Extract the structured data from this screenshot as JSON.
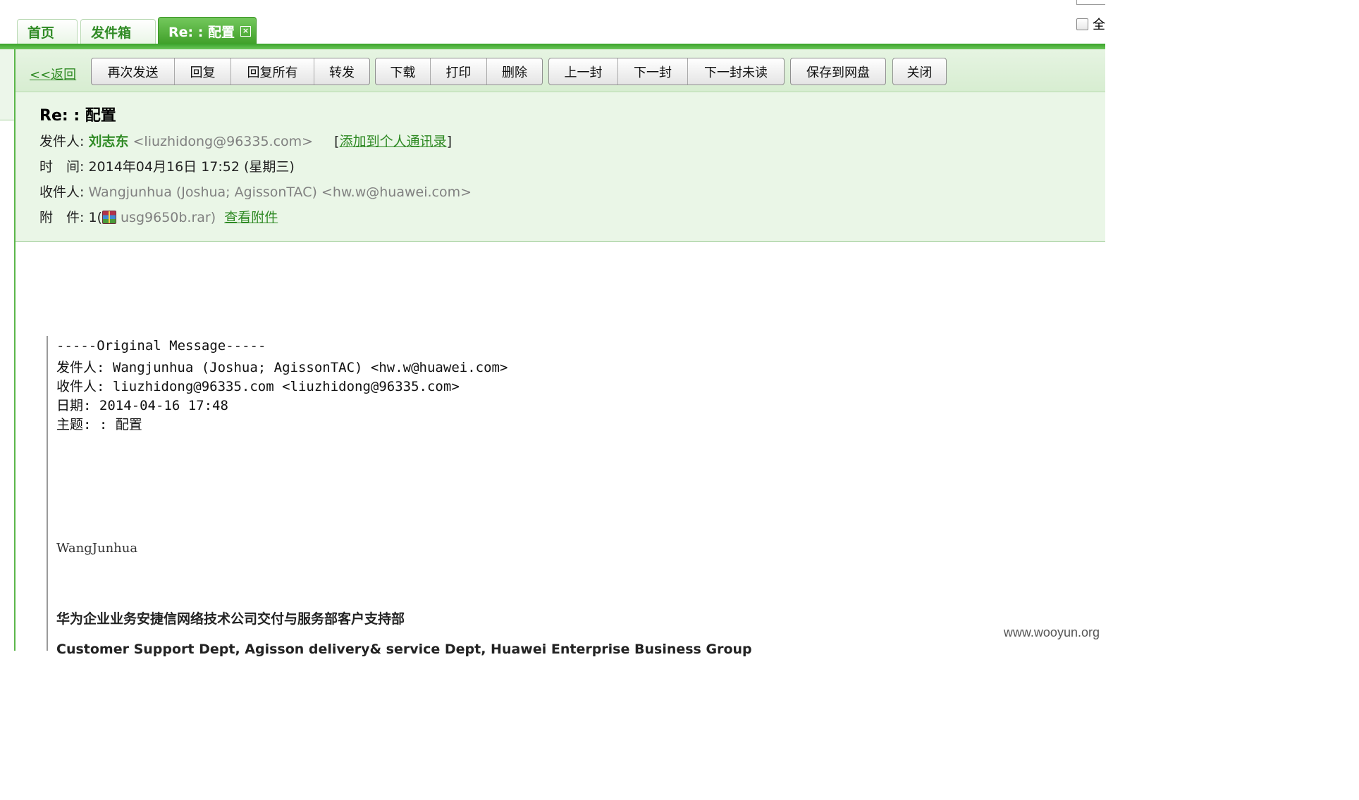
{
  "select_all": {
    "label": "全"
  },
  "tabs": [
    {
      "label": "首页"
    },
    {
      "label": "发件箱"
    },
    {
      "label": "Re: : 配置",
      "close": "×"
    }
  ],
  "toolbar": {
    "back": "<<返回",
    "groups": [
      [
        "再次发送",
        "回复",
        "回复所有",
        "转发"
      ],
      [
        "下载",
        "打印",
        "删除"
      ],
      [
        "上一封",
        "下一封",
        "下一封未读"
      ],
      [
        "保存到网盘"
      ],
      [
        "关闭"
      ]
    ]
  },
  "header": {
    "subject": "Re: : 配置",
    "from_label": "发件人:",
    "from_name": "刘志东",
    "from_email": "<liuzhidong@96335.com>",
    "add_contact": "添加到个人通讯录",
    "time_label": "时　间:",
    "time_value": "2014年04月16日 17:52 (星期三)",
    "to_label": "收件人:",
    "to_value": "Wangjunhua (Joshua; AgissonTAC) <hw.w@huawei.com>",
    "attach_label": "附　件:",
    "attach_count": "1(",
    "attach_name": "usg9650b.rar)",
    "attach_view": "查看附件"
  },
  "body": {
    "original_header": "-----Original Message-----",
    "from_line": "发件人: Wangjunhua (Joshua; AgissonTAC) <hw.w@huawei.com>",
    "to_line": "收件人: liuzhidong@96335.com <liuzhidong@96335.com>",
    "date_line": "日期: 2014-04-16 17:48",
    "subject_line": "主题: : 配置",
    "signature_name": "WangJunhua",
    "signature_cn": "华为企业业务安捷信网络技术公司交付与服务部客户支持部",
    "signature_en": "Customer Support Dept, Agisson delivery& service Dept, Huawei Enterprise Business Group"
  },
  "watermark": "www.wooyun.org"
}
